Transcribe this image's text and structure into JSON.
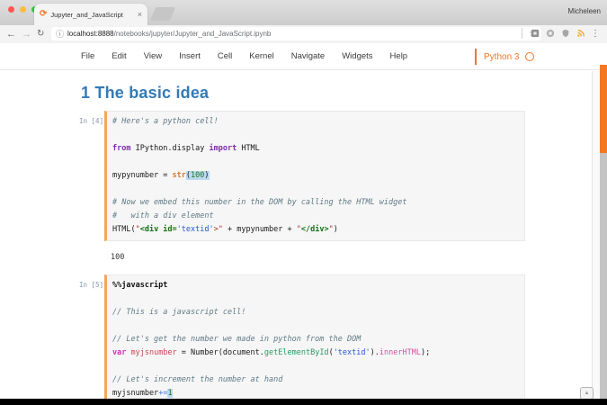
{
  "browser": {
    "window_user": "Micheleen",
    "tab_title": "Jupyter_and_JavaScript",
    "url_host": "localhost:8888",
    "url_path": "/notebooks/jupyter/Jupyter_and_JavaScript.ipynb"
  },
  "icons": {
    "back": "←",
    "forward": "→",
    "reload": "↻",
    "info": "ⓘ",
    "star": "☆",
    "tab_close": "×",
    "favicon": "⟳",
    "menu_dots": "⋮",
    "badge_glyph": "▲"
  },
  "colors": {
    "jupyter_orange": "#f37626",
    "heading_blue": "#337ab7",
    "cell_border_orange": "#f5a55a"
  },
  "notebook": {
    "menu": {
      "items": [
        "File",
        "Edit",
        "View",
        "Insert",
        "Cell",
        "Kernel",
        "Navigate",
        "Widgets",
        "Help"
      ]
    },
    "kernel": {
      "name": "Python 3"
    },
    "heading": {
      "text": "1  The basic idea"
    },
    "cells": [
      {
        "prompt": "In [4]:",
        "output": "100",
        "lines": [
          [
            {
              "c": "com",
              "t": "# Here's a python cell!"
            }
          ],
          [],
          [
            {
              "c": "kw",
              "t": "from"
            },
            {
              "t": " IPython.display "
            },
            {
              "c": "kw",
              "t": "import"
            },
            {
              "t": " HTML"
            }
          ],
          [],
          [
            {
              "t": "mypynumber = "
            },
            {
              "c": "bi",
              "t": "str"
            },
            {
              "c": "hl",
              "t": "("
            },
            {
              "c": "num hl",
              "t": "100"
            },
            {
              "c": "hl",
              "t": ")"
            }
          ],
          [],
          [
            {
              "c": "com",
              "t": "# Now we embed this number in the DOM by calling the HTML widget"
            }
          ],
          [
            {
              "c": "com",
              "t": "#   with a div element"
            }
          ],
          [
            {
              "t": "HTML("
            },
            {
              "c": "str",
              "t": "\""
            },
            {
              "c": "tag",
              "t": "<div id="
            },
            {
              "c": "atr",
              "t": "'textid'"
            },
            {
              "c": "str",
              "t": ">\""
            },
            {
              "t": " + mypynumber + "
            },
            {
              "c": "str",
              "t": "\""
            },
            {
              "c": "tag",
              "t": "</div>"
            },
            {
              "c": "str",
              "t": "\""
            },
            {
              "t": ")"
            }
          ]
        ]
      },
      {
        "prompt": "In [5]:",
        "lines": [
          [
            {
              "c": "mag",
              "t": "%%javascript"
            }
          ],
          [],
          [
            {
              "c": "com",
              "t": "// This is a javascript cell!"
            }
          ],
          [],
          [
            {
              "c": "com",
              "t": "// Let's get the number we made in python from the DOM"
            }
          ],
          [
            {
              "c": "kw2",
              "t": "var"
            },
            {
              "t": " "
            },
            {
              "c": "def",
              "t": "myjsnumber"
            },
            {
              "t": " = Number(document."
            },
            {
              "c": "prG",
              "t": "getElementById"
            },
            {
              "t": "("
            },
            {
              "c": "atr",
              "t": "'textid'"
            },
            {
              "t": ")."
            },
            {
              "c": "prP",
              "t": "innerHTML"
            },
            {
              "t": ");"
            }
          ],
          [],
          [
            {
              "c": "com",
              "t": "// Let's increment the number at hand"
            }
          ],
          [
            {
              "t": "myjsnumber"
            },
            {
              "c": "op",
              "t": "+="
            },
            {
              "c": "num hl",
              "t": "1"
            }
          ]
        ]
      }
    ]
  }
}
